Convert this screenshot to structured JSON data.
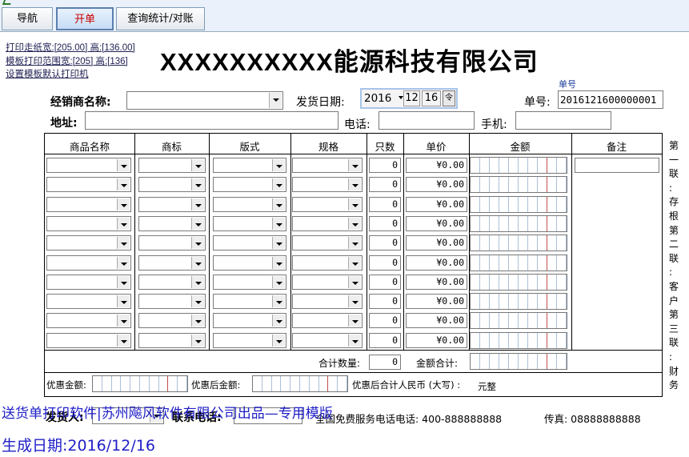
{
  "tabs": {
    "nav": "导航",
    "new": "开单",
    "stats": "查询统计/对账"
  },
  "print_links": {
    "paper": "打印走纸宽:[205.00] 高:[136.00]",
    "range": "模板打印范围宽:[205] 高:[136]",
    "printer": "设置模板默认打印机"
  },
  "company_title": "XXXXXXXXXX能源科技有限公司",
  "form": {
    "dealer_label": "经销商名称:",
    "date_label": "发货日期:",
    "date_year": "2016",
    "date_month": "12",
    "date_day": "16",
    "order_small_label": "单号",
    "order_label": "单号:",
    "order_no": "2016121600000001",
    "address_label": "地址:",
    "phone_label": "电话:",
    "mobile_label": "手机:"
  },
  "table": {
    "headers": [
      "商品名称",
      "商标",
      "版式",
      "规格",
      "只数",
      "单价",
      "金额",
      "备注"
    ],
    "rows": [
      {
        "qty": "0",
        "price": "¥0.00"
      },
      {
        "qty": "0",
        "price": "¥0.00"
      },
      {
        "qty": "0",
        "price": "¥0.00"
      },
      {
        "qty": "0",
        "price": "¥0.00"
      },
      {
        "qty": "0",
        "price": "¥0.00"
      },
      {
        "qty": "0",
        "price": "¥0.00"
      },
      {
        "qty": "0",
        "price": "¥0.00"
      },
      {
        "qty": "0",
        "price": "¥0.00"
      },
      {
        "qty": "0",
        "price": "¥0.00"
      },
      {
        "qty": "0",
        "price": "¥0.00"
      }
    ],
    "total_qty_label": "合计数量:",
    "total_qty": "0",
    "total_amount_label": "金额合计:"
  },
  "discount": {
    "discount_label": "优惠金额:",
    "after_label": "优惠后金额:",
    "upper_label": "优惠后合计人民币 (大写) :",
    "upper_value": "元整"
  },
  "side_text": [
    "第",
    "一",
    "联",
    ":",
    "存",
    "根",
    "第",
    "二",
    "联",
    ":",
    "客",
    "户",
    "第",
    "三",
    "联",
    ":",
    "财",
    "务"
  ],
  "footer": {
    "sender_label": "发货人:",
    "contact_label": "联系电话:",
    "hotline": "全国免费服务电话电话: 400-888888888",
    "fax": "传真: 08888888888"
  },
  "watermark": {
    "line1": "送货单打印软件|苏州飚风软件有限公司出品—专用模版",
    "line2": "生成日期:2016/12/16"
  },
  "colors": {
    "watermark": "#2020c8",
    "active_tab": "#cc0000",
    "amount_divider": "#c0504d"
  }
}
